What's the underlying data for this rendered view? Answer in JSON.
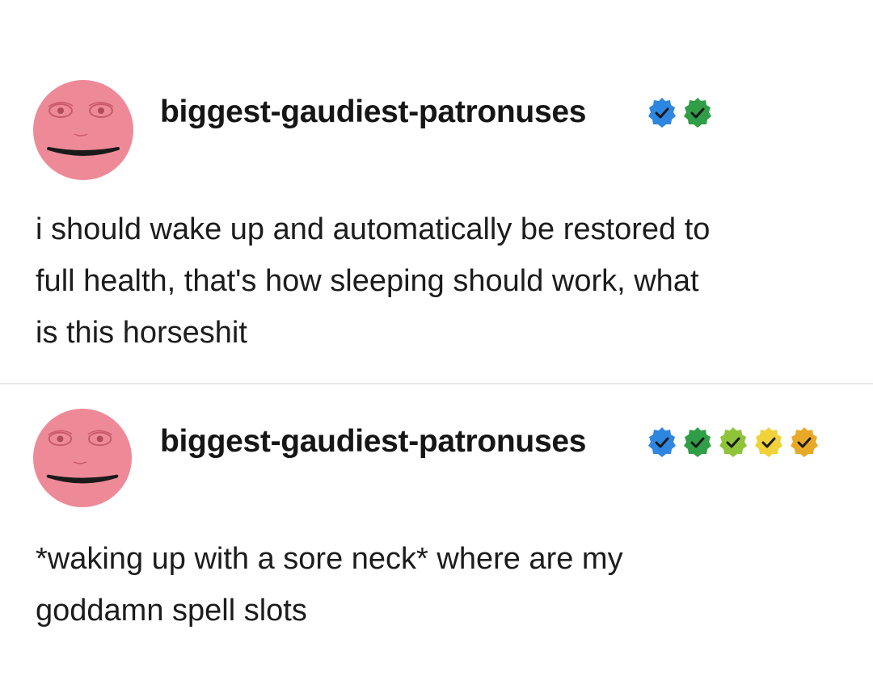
{
  "posts": [
    {
      "username": "biggest-gaudiest-patronuses",
      "badges": [
        {
          "icon": "verified-check-badge-icon",
          "color": "#2f86e0"
        },
        {
          "icon": "verified-check-badge-icon",
          "color": "#2f9e46"
        }
      ],
      "lines": [
        "i should wake up and automatically be restored to",
        "full health, that's how sleeping should work, what",
        "is this horseshit"
      ]
    },
    {
      "username": "biggest-gaudiest-patronuses",
      "badges": [
        {
          "icon": "verified-check-badge-icon",
          "color": "#2f86e0"
        },
        {
          "icon": "verified-check-badge-icon",
          "color": "#2f9e46"
        },
        {
          "icon": "verified-check-badge-icon",
          "color": "#8fc43a"
        },
        {
          "icon": "verified-check-badge-icon",
          "color": "#f0d23a"
        },
        {
          "icon": "verified-check-badge-icon",
          "color": "#e8a928"
        }
      ],
      "lines": [
        "*waking up with a sore neck* where are my",
        "goddamn spell slots"
      ]
    }
  ],
  "colors": {
    "avatar_face": "#ee8a98",
    "text": "#1c1c1c",
    "divider": "#e8e8e8"
  }
}
